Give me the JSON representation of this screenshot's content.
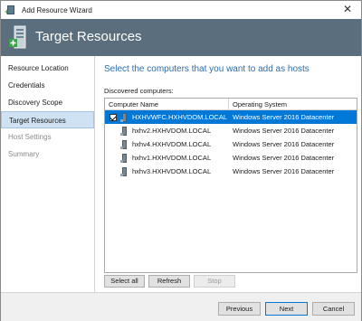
{
  "window": {
    "title": "Add Resource Wizard",
    "close_glyph": "✕"
  },
  "banner": {
    "title": "Target Resources",
    "icon": "server-add-icon",
    "color": "#5a6e7d"
  },
  "nav": {
    "items": [
      {
        "label": "Resource Location",
        "state": "normal"
      },
      {
        "label": "Credentials",
        "state": "normal"
      },
      {
        "label": "Discovery Scope",
        "state": "normal"
      },
      {
        "label": "Target Resources",
        "state": "active"
      },
      {
        "label": "Host Settings",
        "state": "disabled"
      },
      {
        "label": "Summary",
        "state": "disabled"
      }
    ]
  },
  "main": {
    "heading": "Select the computers that you want to add as hosts",
    "discovered_label": "Discovered computers:",
    "columns": [
      "Computer Name",
      "Operating System"
    ],
    "rows": [
      {
        "name": "HXHVWFC.HXHVDOM.LOCAL",
        "os": "Windows Server 2016 Datacenter",
        "checked": true,
        "selected": true
      },
      {
        "name": "hxhv2.HXHVDOM.LOCAL",
        "os": "Windows Server 2016 Datacenter",
        "checked": false,
        "selected": false
      },
      {
        "name": "hxhv4.HXHVDOM.LOCAL",
        "os": "Windows Server 2016 Datacenter",
        "checked": false,
        "selected": false
      },
      {
        "name": "hxhv1.HXHVDOM.LOCAL",
        "os": "Windows Server 2016 Datacenter",
        "checked": false,
        "selected": false
      },
      {
        "name": "hxhv3.HXHVDOM.LOCAL",
        "os": "Windows Server 2016 Datacenter",
        "checked": false,
        "selected": false
      }
    ],
    "buttons": {
      "select_all": "Select all",
      "refresh": "Refresh",
      "stop": "Stop"
    }
  },
  "footer": {
    "previous": "Previous",
    "next": "Next",
    "cancel": "Cancel"
  },
  "colors": {
    "accent": "#0078d7",
    "heading": "#2d6ca8",
    "nav_active": "#cfe2f3"
  }
}
